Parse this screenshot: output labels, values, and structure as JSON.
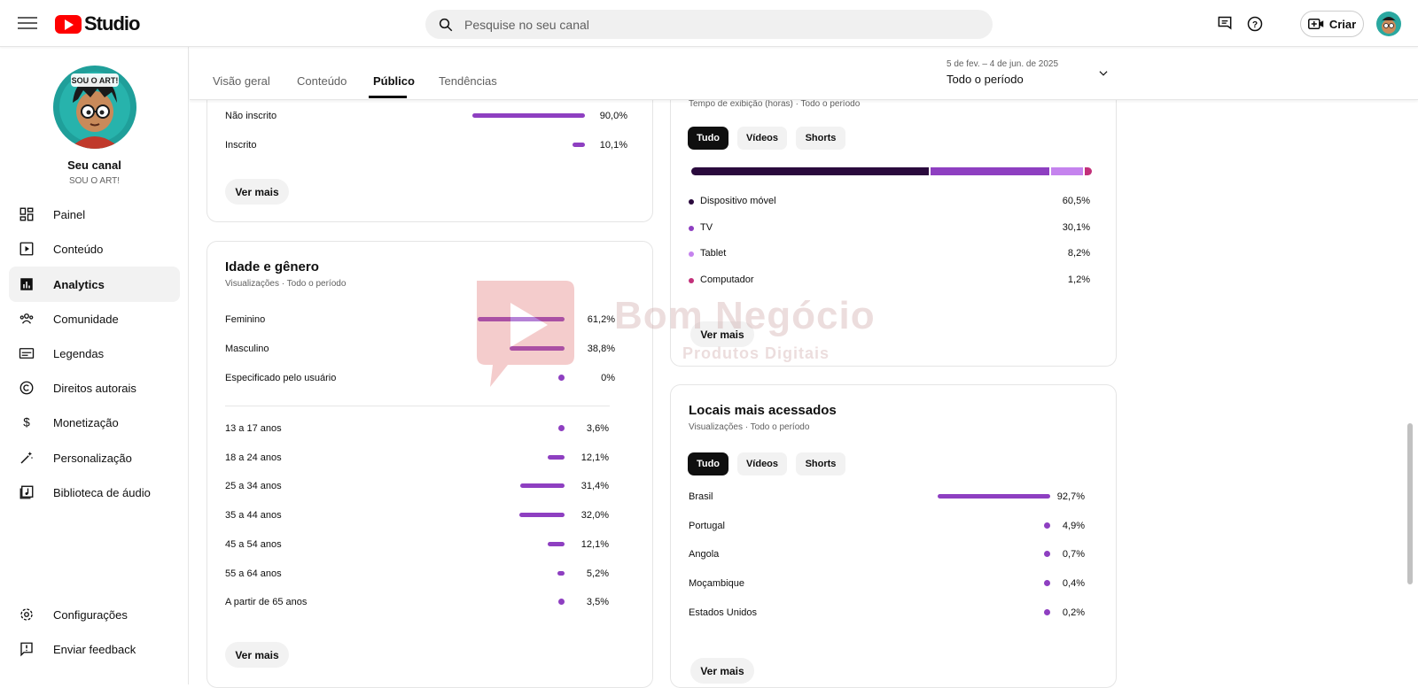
{
  "header": {
    "logo_text": "Studio",
    "search_placeholder": "Pesquise no seu canal",
    "create_label": "Criar"
  },
  "sidebar": {
    "channel_name": "Seu canal",
    "channel_handle": "SOU O ART!",
    "avatar_caption": "SOU O ART!",
    "items": [
      {
        "label": "Painel",
        "icon": "dashboard-icon"
      },
      {
        "label": "Conteúdo",
        "icon": "content-icon"
      },
      {
        "label": "Analytics",
        "icon": "analytics-icon",
        "active": true
      },
      {
        "label": "Comunidade",
        "icon": "community-icon"
      },
      {
        "label": "Legendas",
        "icon": "subtitles-icon"
      },
      {
        "label": "Direitos autorais",
        "icon": "copyright-icon"
      },
      {
        "label": "Monetização",
        "icon": "monetization-icon"
      },
      {
        "label": "Personalização",
        "icon": "customization-icon"
      },
      {
        "label": "Biblioteca de áudio",
        "icon": "audio-library-icon"
      }
    ],
    "bottom_items": [
      {
        "label": "Configurações",
        "icon": "settings-icon"
      },
      {
        "label": "Enviar feedback",
        "icon": "feedback-icon"
      }
    ]
  },
  "tabs": [
    "Visão geral",
    "Conteúdo",
    "Público",
    "Tendências"
  ],
  "active_tab": "Público",
  "date_range": {
    "range": "5 de fev. – 4 de jun. de 2025",
    "label": "Todo o período"
  },
  "subscription_card": {
    "rows": [
      {
        "label": "Não inscrito",
        "value": "90,0%",
        "pct": 90.0
      },
      {
        "label": "Inscrito",
        "value": "10,1%",
        "pct": 10.1
      }
    ],
    "button": "Ver mais"
  },
  "age_gender_card": {
    "title": "Idade e gênero",
    "subtitle": "Visualizações · Todo o período",
    "gender_rows": [
      {
        "label": "Feminino",
        "value": "61,2%",
        "pct": 61.2
      },
      {
        "label": "Masculino",
        "value": "38,8%",
        "pct": 38.8
      },
      {
        "label": "Especificado pelo usuário",
        "value": "0%",
        "pct": 0
      }
    ],
    "age_rows": [
      {
        "label": "13 a 17 anos",
        "value": "3,6%",
        "pct": 3.6
      },
      {
        "label": "18 a 24 anos",
        "value": "12,1%",
        "pct": 12.1
      },
      {
        "label": "25 a 34 anos",
        "value": "31,4%",
        "pct": 31.4
      },
      {
        "label": "35 a 44 anos",
        "value": "32,0%",
        "pct": 32.0
      },
      {
        "label": "45 a 54 anos",
        "value": "12,1%",
        "pct": 12.1
      },
      {
        "label": "55 a 64 anos",
        "value": "5,2%",
        "pct": 5.2
      },
      {
        "label": "A partir de 65 anos",
        "value": "3,5%",
        "pct": 3.5
      }
    ],
    "button": "Ver mais"
  },
  "device_card": {
    "subtitle": "Tempo de exibição (horas) · Todo o período",
    "chips": [
      "Tudo",
      "Vídeos",
      "Shorts"
    ],
    "rows": [
      {
        "label": "Dispositivo móvel",
        "value": "60,5%",
        "pct": 60.5,
        "color": "#2a0a3d"
      },
      {
        "label": "TV",
        "value": "30,1%",
        "pct": 30.1,
        "color": "#8e3fc1"
      },
      {
        "label": "Tablet",
        "value": "8,2%",
        "pct": 8.2,
        "color": "#c583ee"
      },
      {
        "label": "Computador",
        "value": "1,2%",
        "pct": 1.2,
        "color": "#c2307a"
      }
    ],
    "button": "Ver mais"
  },
  "locations_card": {
    "title": "Locais mais acessados",
    "subtitle": "Visualizações · Todo o período",
    "chips": [
      "Tudo",
      "Vídeos",
      "Shorts"
    ],
    "rows": [
      {
        "label": "Brasil",
        "value": "92,7%",
        "pct": 92.7
      },
      {
        "label": "Portugal",
        "value": "4,9%",
        "pct": 4.9
      },
      {
        "label": "Angola",
        "value": "0,7%",
        "pct": 0.7
      },
      {
        "label": "Moçambique",
        "value": "0,4%",
        "pct": 0.4
      },
      {
        "label": "Estados Unidos",
        "value": "0,2%",
        "pct": 0.2
      }
    ],
    "button": "Ver mais"
  },
  "watermark": {
    "brand": "Bom Negócio",
    "tagline": "Produtos Digitais"
  },
  "colors": {
    "accent": "#8e3fc1",
    "youtube_red": "#ff0000"
  }
}
